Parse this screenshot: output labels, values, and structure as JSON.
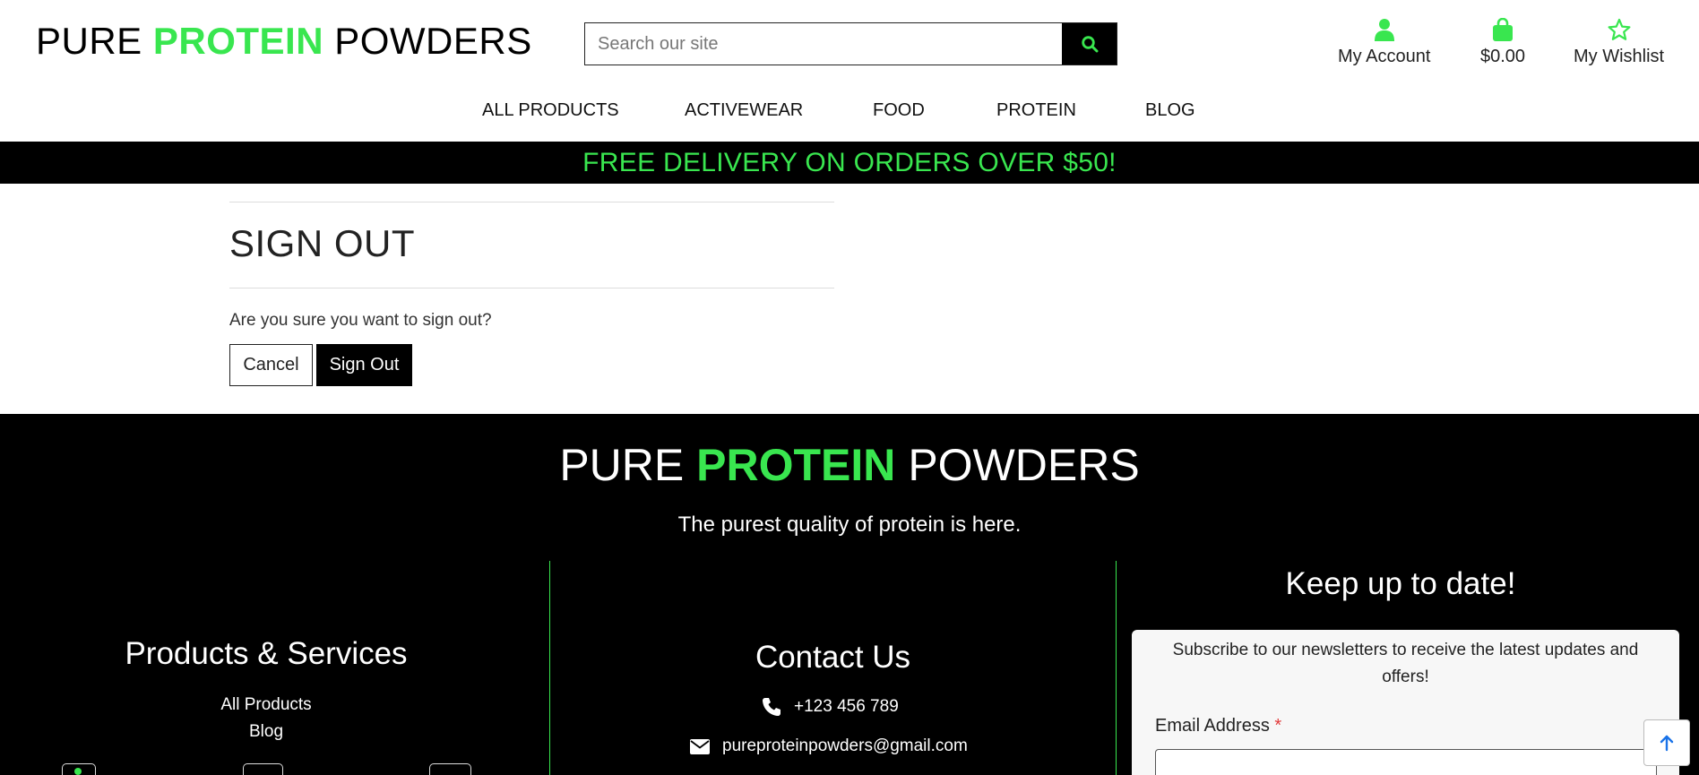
{
  "header": {
    "logo": {
      "part1": "PURE",
      "accent": "PROTEIN",
      "part2": "POWDERS"
    },
    "search": {
      "placeholder": "Search our site",
      "icon": "search-icon"
    },
    "tools": [
      {
        "label": "My Account",
        "icon": "user-icon"
      },
      {
        "label": "$0.00",
        "icon": "shopping-bag-icon"
      },
      {
        "label": "My Wishlist",
        "icon": "star-icon"
      }
    ],
    "nav": [
      "ALL PRODUCTS",
      "ACTIVEWEAR",
      "FOOD",
      "PROTEIN",
      "BLOG"
    ]
  },
  "banner": {
    "text": "FREE DELIVERY ON ORDERS OVER $50!"
  },
  "main": {
    "title": "SIGN OUT",
    "question": "Are you sure you want to sign out?",
    "cancel_label": "Cancel",
    "signout_label": "Sign Out"
  },
  "footer": {
    "logo": {
      "part1": "PURE",
      "accent": "PROTEIN",
      "part2": "POWDERS"
    },
    "tagline": "The purest quality of protein is here.",
    "products": {
      "title": "Products & Services",
      "links": [
        "All Products",
        "Blog"
      ]
    },
    "contact": {
      "title": "Contact Us",
      "phone": "+123 456 789",
      "email": "pureproteinpowders@gmail.com"
    },
    "newsletter": {
      "title": "Keep up to date!",
      "text": "Subscribe to our newsletters to receive the latest updates and offers!",
      "email_label": "Email Address",
      "required_mark": "*"
    }
  },
  "colors": {
    "accent": "#39e64f",
    "black": "#000000",
    "white": "#ffffff",
    "required": "#e23b3b"
  }
}
